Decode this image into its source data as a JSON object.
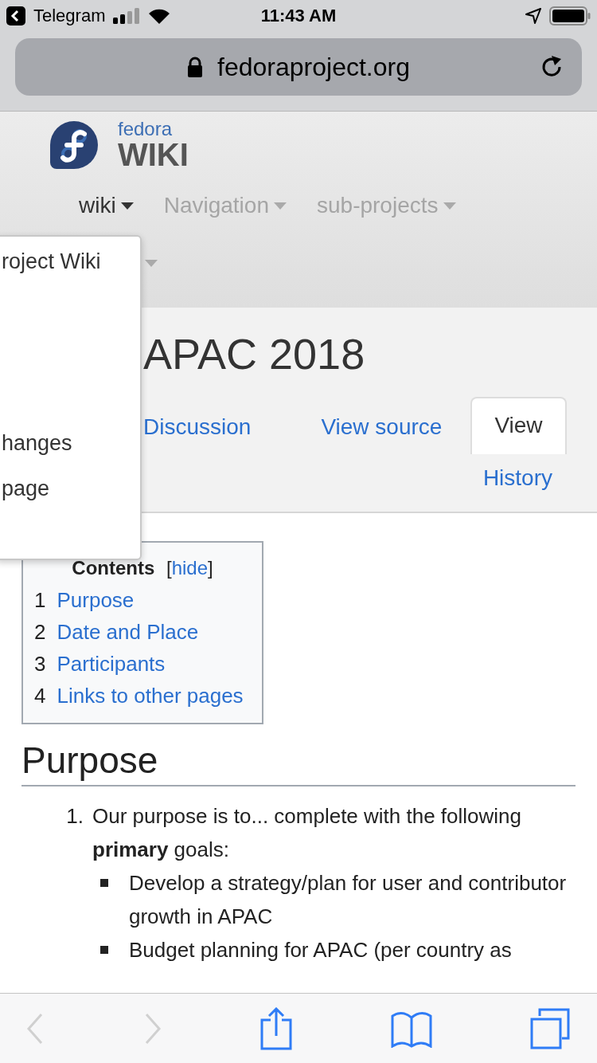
{
  "status_bar": {
    "back_app": "Telegram",
    "time": "11:43 AM"
  },
  "address_bar": {
    "url": "fedoraproject.org"
  },
  "site_header": {
    "logo_top": "fedora",
    "logo_bottom": "WIKI",
    "nav": [
      {
        "label": "wiki",
        "selected": true
      },
      {
        "label": "Navigation",
        "selected": false
      },
      {
        "label": "sub-projects",
        "selected": false
      }
    ]
  },
  "dropdown_menu": {
    "items": [
      "roject Wiki",
      "hanges",
      "page"
    ]
  },
  "page": {
    "title": "APAC 2018",
    "tabs": [
      {
        "label": "Discussion",
        "selected": false
      },
      {
        "label": "View source",
        "selected": false
      },
      {
        "label": "View",
        "selected": true
      }
    ],
    "history_tab": "History"
  },
  "toc": {
    "title": "Contents",
    "bracket_open": "[",
    "toggle": "hide",
    "bracket_close": "]",
    "items": [
      {
        "number": "1",
        "label": "Purpose"
      },
      {
        "number": "2",
        "label": "Date and Place"
      },
      {
        "number": "3",
        "label": "Participants"
      },
      {
        "number": "4",
        "label": "Links to other pages"
      }
    ]
  },
  "section": {
    "heading": "Purpose",
    "list": [
      {
        "number": "1.",
        "text": "Our purpose is to... complete with the following **primary** goals:",
        "bullets": [
          "Develop a strategy/plan for user and contributor growth in APAC",
          "Budget planning for APAC (per country as"
        ]
      }
    ]
  },
  "toolbar": {
    "back_disabled": true,
    "forward_disabled": true
  }
}
